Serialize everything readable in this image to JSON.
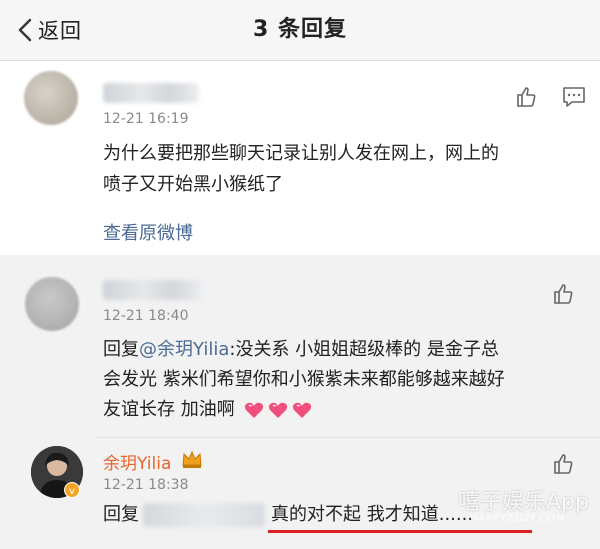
{
  "header": {
    "back_label": "返回",
    "title": "3 条回复"
  },
  "main_comment": {
    "time": "12-21 16:19",
    "text_line1": "为什么要把那些聊天记录让别人发在网上，网上的",
    "text_line2": "喷子又开始黑小猴纸了",
    "view_original": "查看原微博"
  },
  "replies": [
    {
      "time": "12-21 18:40",
      "prefix": "回复",
      "mention": "@余玥Yilia",
      "line1_rest": ":没关系  小姐姐超级棒的  是金子总",
      "line2": "会发光  紫米们希望你和小猴紫未来都能够越来越好",
      "line3": "友谊长存  加油啊"
    },
    {
      "username": "余玥Yilia",
      "time": "12-21 18:38",
      "prefix": "回复",
      "text": "真的对不起 我才知道......"
    }
  ],
  "watermark": {
    "brand": "嘻子娱乐App",
    "site": "HAPPYZUZI.COM"
  },
  "colors": {
    "link": "#4b6a95",
    "reply_bg": "#f2f2f2",
    "heart": "#f04e7c",
    "underline": "#e02020",
    "crown": "#f0a020"
  },
  "icons": [
    "chevron-left-icon",
    "like-icon",
    "comment-icon",
    "heart-icon",
    "crown-icon"
  ]
}
